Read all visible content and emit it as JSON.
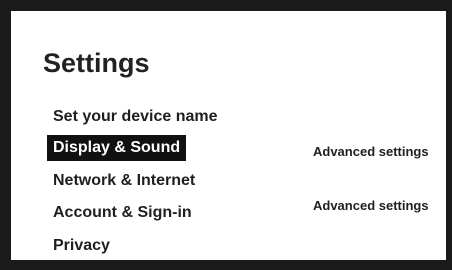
{
  "header": {
    "title": "Settings"
  },
  "menu": {
    "items": [
      {
        "label": "Set your device name",
        "selected": false
      },
      {
        "label": "Display & Sound",
        "selected": true
      },
      {
        "label": "Network & Internet",
        "selected": false
      },
      {
        "label": "Account & Sign-in",
        "selected": false
      },
      {
        "label": "Privacy",
        "selected": false
      }
    ]
  },
  "secondary": {
    "links": [
      {
        "label": "Advanced settings"
      },
      {
        "label": "Advanced settings"
      }
    ]
  },
  "colors": {
    "frame": "#1a1a1a",
    "background": "#ffffff",
    "text": "#1f1f1f",
    "selected_bg": "#111111",
    "selected_text": "#ffffff"
  }
}
